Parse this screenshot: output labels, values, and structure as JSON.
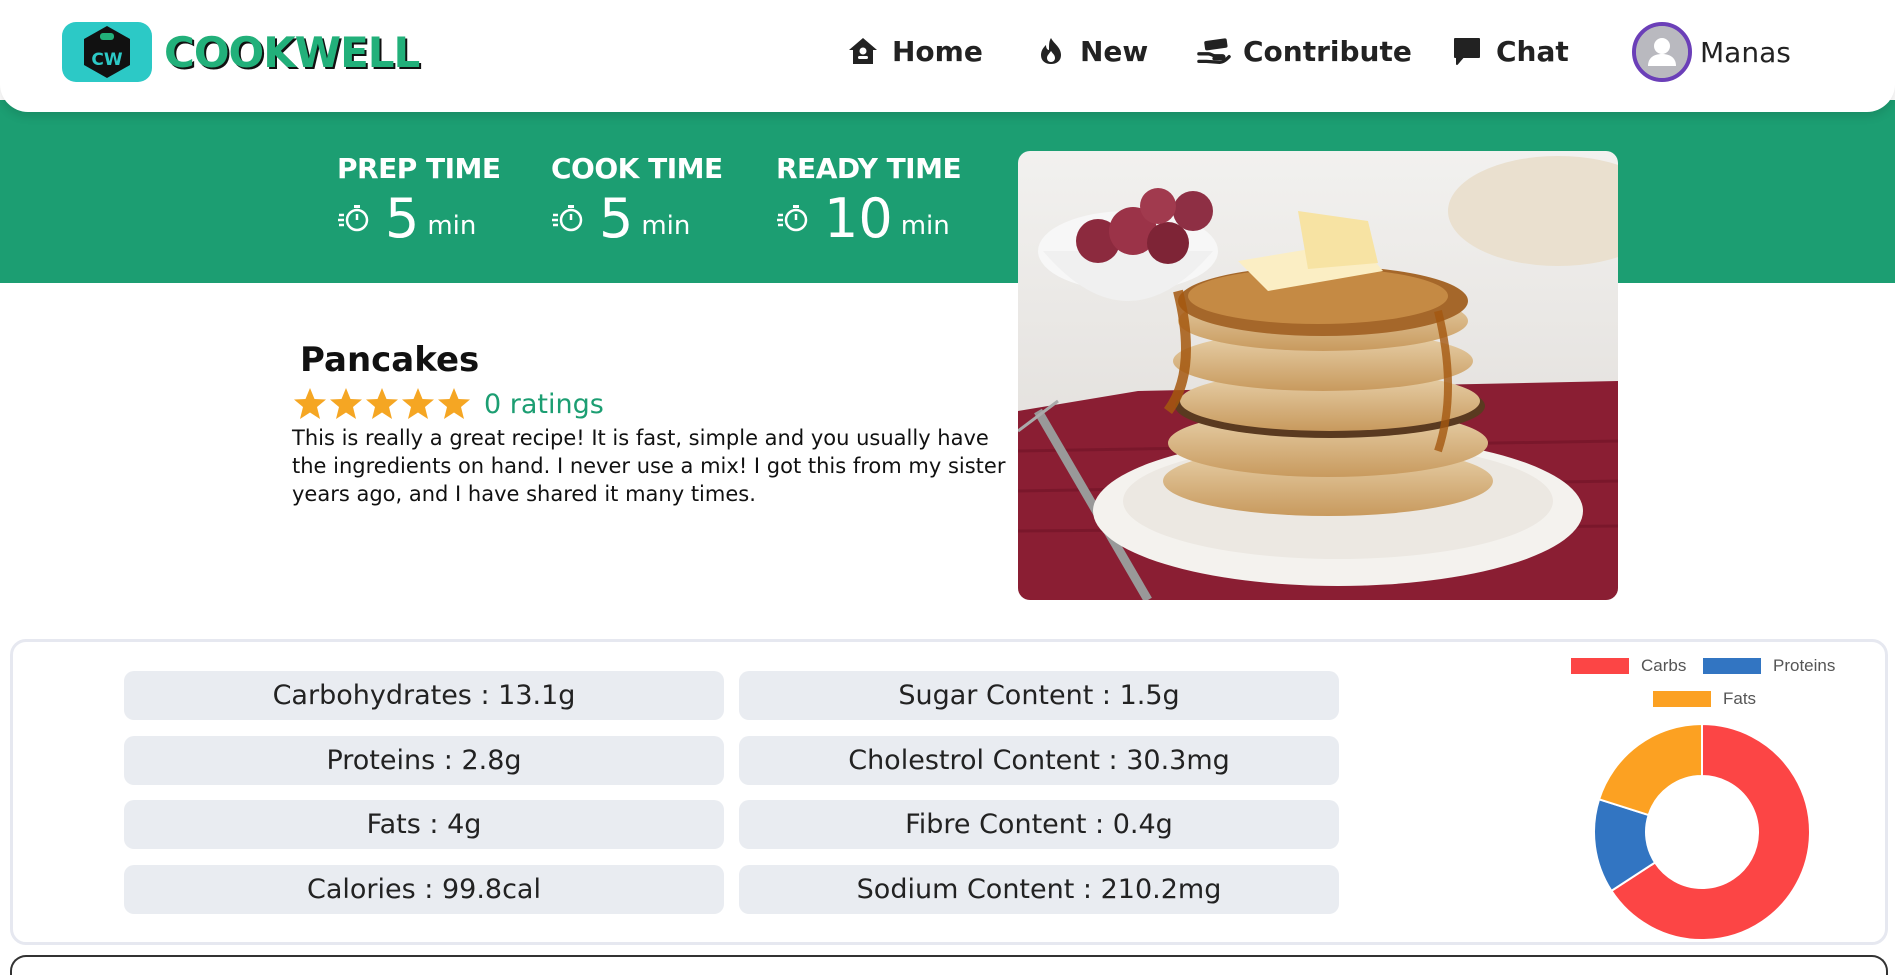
{
  "app": {
    "logo_badge": "CW",
    "logo_text": "COOKWELL"
  },
  "nav": {
    "items": [
      {
        "label": "Home",
        "icon": "home-icon"
      },
      {
        "label": "New",
        "icon": "flame-icon"
      },
      {
        "label": "Contribute",
        "icon": "hand-money-icon"
      },
      {
        "label": "Chat",
        "icon": "chat-icon"
      }
    ],
    "user": {
      "name": "Manas"
    }
  },
  "times": [
    {
      "label": "PREP TIME",
      "value": "5",
      "unit": "min"
    },
    {
      "label": "COOK TIME",
      "value": "5",
      "unit": "min"
    },
    {
      "label": "READY TIME",
      "value": "10",
      "unit": "min"
    }
  ],
  "recipe": {
    "title": "Pancakes",
    "stars": 5,
    "ratings_text": "0 ratings",
    "description": "This is really a great recipe! It is fast, simple and you usually have the ingredients on hand. I never use a mix! I got this from my sister years ago, and I have shared it many times."
  },
  "nutrition": {
    "items": [
      "Carbohydrates : 13.1g",
      "Sugar Content : 1.5g",
      "Proteins : 2.8g",
      "Cholestrol Content : 30.3mg",
      "Fats : 4g",
      "Fibre Content : 0.4g",
      "Calories : 99.8cal",
      "Sodium Content : 210.2mg"
    ]
  },
  "colors": {
    "brand_green": "#1c9e72",
    "star": "#f5a623",
    "carbs": "#fc4545",
    "proteins": "#3275c2",
    "fats": "#fca122"
  },
  "chart_data": {
    "type": "pie",
    "variant": "doughnut",
    "categories": [
      "Carbs",
      "Proteins",
      "Fats"
    ],
    "values": [
      13.1,
      2.8,
      4
    ],
    "colors": [
      "#fc4545",
      "#3275c2",
      "#fca122"
    ],
    "legend": "top"
  }
}
